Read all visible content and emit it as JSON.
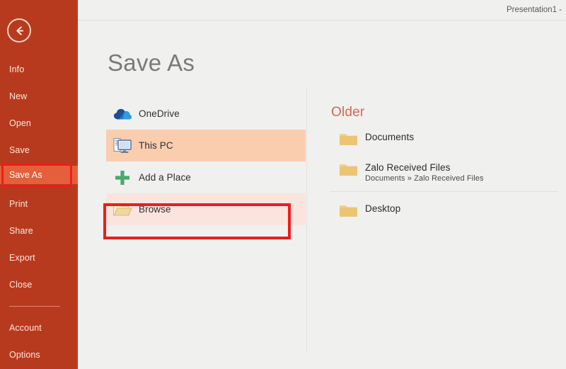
{
  "window": {
    "title": "Presentation1 -"
  },
  "sidebar": {
    "back_icon": "back-arrow-icon",
    "items": [
      {
        "label": "Info",
        "selected": false
      },
      {
        "label": "New",
        "selected": false
      },
      {
        "label": "Open",
        "selected": false
      },
      {
        "label": "Save",
        "selected": false
      },
      {
        "label": "Save As",
        "selected": true
      },
      {
        "label": "Print",
        "selected": false
      },
      {
        "label": "Share",
        "selected": false
      },
      {
        "label": "Export",
        "selected": false
      },
      {
        "label": "Close",
        "selected": false
      },
      {
        "label": "Account",
        "selected": false
      },
      {
        "label": "Options",
        "selected": false
      }
    ]
  },
  "main": {
    "page_title": "Save As",
    "places": [
      {
        "label": "OneDrive",
        "icon": "onedrive-cloud-icon",
        "selected": false
      },
      {
        "label": "This PC",
        "icon": "this-pc-monitor-icon",
        "selected": true
      },
      {
        "label": "Add a Place",
        "icon": "plus-icon",
        "selected": false
      },
      {
        "label": "Browse",
        "icon": "open-folder-icon",
        "selected": false
      }
    ]
  },
  "recent": {
    "heading": "Older",
    "folders": [
      {
        "name": "Documents",
        "path": "",
        "icon": "folder-icon"
      },
      {
        "name": "Zalo Received Files",
        "path": "Documents » Zalo Received Files",
        "icon": "folder-icon"
      },
      {
        "name": "Desktop",
        "path": "",
        "icon": "folder-icon"
      }
    ]
  },
  "colors": {
    "sidebar_background": "#b83a1e",
    "sidebar_selected": "#e5603a",
    "annotation_red": "#ee1c1c",
    "place_selected": "#facdaf",
    "browse_fill": "#fce4de",
    "page_background": "#f0f0ef",
    "older_heading": "#d2694d",
    "folder_yellow": "#efc978",
    "onedrive_blue": "#1a78c8",
    "add_place_green": "#4aa96c"
  }
}
